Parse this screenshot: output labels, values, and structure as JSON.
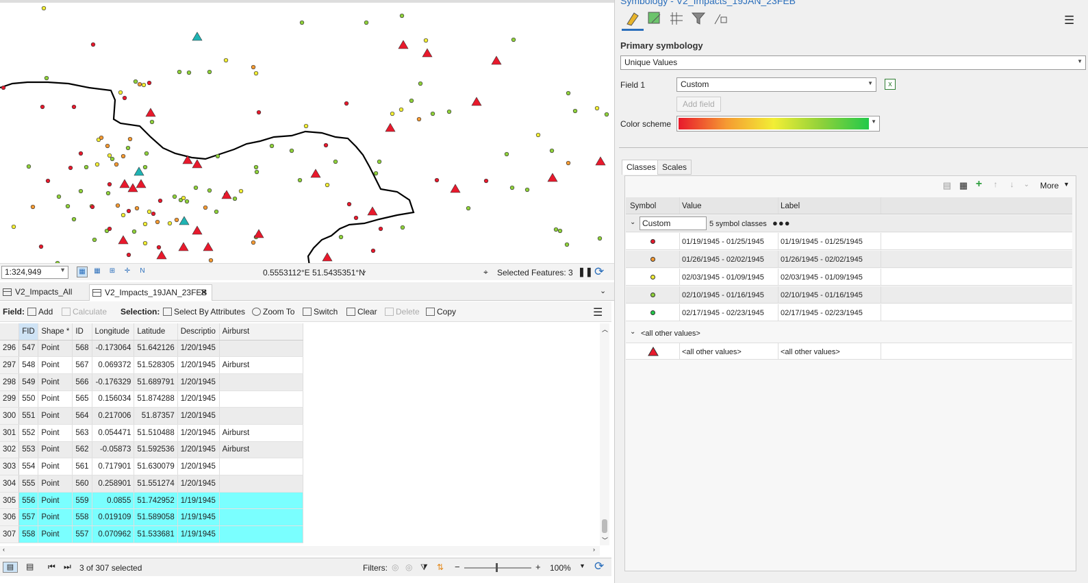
{
  "map": {
    "scale": "1:324,949",
    "coords": "0.5553112°E 51.5435351°N",
    "selected_features": "Selected Features: 3"
  },
  "tabs": [
    {
      "label": "V2_Impacts_All"
    },
    {
      "label": "V2_Impacts_19JAN_23FEB"
    }
  ],
  "table_toolbar": {
    "field_label": "Field:",
    "add": "Add",
    "calculate": "Calculate",
    "selection_label": "Selection:",
    "select_by_attributes": "Select By Attributes",
    "zoom_to": "Zoom To",
    "switch": "Switch",
    "clear": "Clear",
    "delete": "Delete",
    "copy": "Copy"
  },
  "grid": {
    "columns": [
      "FID",
      "Shape *",
      "ID",
      "Longitude",
      "Latitude",
      "Descriptio",
      "Airburst"
    ],
    "rows": [
      {
        "rn": "296",
        "fid": "547",
        "shape": "Point",
        "id": "568",
        "lon": "-0.173064",
        "lat": "51.642126",
        "desc": "1/20/1945",
        "air": "",
        "sel": false
      },
      {
        "rn": "297",
        "fid": "548",
        "shape": "Point",
        "id": "567",
        "lon": "0.069372",
        "lat": "51.528305",
        "desc": "1/20/1945",
        "air": "Airburst",
        "sel": false
      },
      {
        "rn": "298",
        "fid": "549",
        "shape": "Point",
        "id": "566",
        "lon": "-0.176329",
        "lat": "51.689791",
        "desc": "1/20/1945",
        "air": "",
        "sel": false
      },
      {
        "rn": "299",
        "fid": "550",
        "shape": "Point",
        "id": "565",
        "lon": "0.156034",
        "lat": "51.874288",
        "desc": "1/20/1945",
        "air": "",
        "sel": false
      },
      {
        "rn": "300",
        "fid": "551",
        "shape": "Point",
        "id": "564",
        "lon": "0.217006",
        "lat": "51.87357",
        "desc": "1/20/1945",
        "air": "",
        "sel": false
      },
      {
        "rn": "301",
        "fid": "552",
        "shape": "Point",
        "id": "563",
        "lon": "0.054471",
        "lat": "51.510488",
        "desc": "1/20/1945",
        "air": "Airburst",
        "sel": false
      },
      {
        "rn": "302",
        "fid": "553",
        "shape": "Point",
        "id": "562",
        "lon": "-0.05873",
        "lat": "51.592536",
        "desc": "1/20/1945",
        "air": "Airburst",
        "sel": false
      },
      {
        "rn": "303",
        "fid": "554",
        "shape": "Point",
        "id": "561",
        "lon": "0.717901",
        "lat": "51.630079",
        "desc": "1/20/1945",
        "air": "",
        "sel": false
      },
      {
        "rn": "304",
        "fid": "555",
        "shape": "Point",
        "id": "560",
        "lon": "0.258901",
        "lat": "51.551274",
        "desc": "1/20/1945",
        "air": "",
        "sel": false
      },
      {
        "rn": "305",
        "fid": "556",
        "shape": "Point",
        "id": "559",
        "lon": "0.0855",
        "lat": "51.742952",
        "desc": "1/19/1945",
        "air": "",
        "sel": true
      },
      {
        "rn": "306",
        "fid": "557",
        "shape": "Point",
        "id": "558",
        "lon": "0.019109",
        "lat": "51.589058",
        "desc": "1/19/1945",
        "air": "",
        "sel": true
      },
      {
        "rn": "307",
        "fid": "558",
        "shape": "Point",
        "id": "557",
        "lon": "0.070962",
        "lat": "51.533681",
        "desc": "1/19/1945",
        "air": "",
        "sel": true
      }
    ]
  },
  "status": {
    "selected_count": "3 of 307 selected",
    "filters_label": "Filters:",
    "zoom": "100%"
  },
  "symbology": {
    "title": "Symbology - V2_Impacts_19JAN_23FEB",
    "primary_label": "Primary symbology",
    "primary_value": "Unique Values",
    "field1_label": "Field 1",
    "field1_value": "Custom",
    "add_field": "Add field",
    "color_scheme_label": "Color scheme",
    "tab_classes": "Classes",
    "tab_scales": "Scales",
    "more": "More",
    "headers": [
      "Symbol",
      "Value",
      "Label"
    ],
    "group_name": "Custom",
    "group_count": "5 symbol classes",
    "classes": [
      {
        "value": "01/19/1945 - 01/25/1945",
        "label": "01/19/1945 - 01/25/1945",
        "color": "#e8192c"
      },
      {
        "value": "01/26/1945 - 02/02/1945",
        "label": "01/26/1945 - 02/02/1945",
        "color": "#f59a32"
      },
      {
        "value": "02/03/1945 - 01/09/1945",
        "label": "02/03/1945 - 01/09/1945",
        "color": "#f2ee35"
      },
      {
        "value": "02/10/1945 - 01/16/1945",
        "label": "02/10/1945 - 01/16/1945",
        "color": "#8fd13a"
      },
      {
        "value": "02/17/1945 - 02/23/1945",
        "label": "02/17/1945 - 02/23/1945",
        "color": "#23c94a"
      }
    ],
    "other_group": "<all other values>",
    "other_value": "<all other values>",
    "other_label": "<all other values>"
  }
}
